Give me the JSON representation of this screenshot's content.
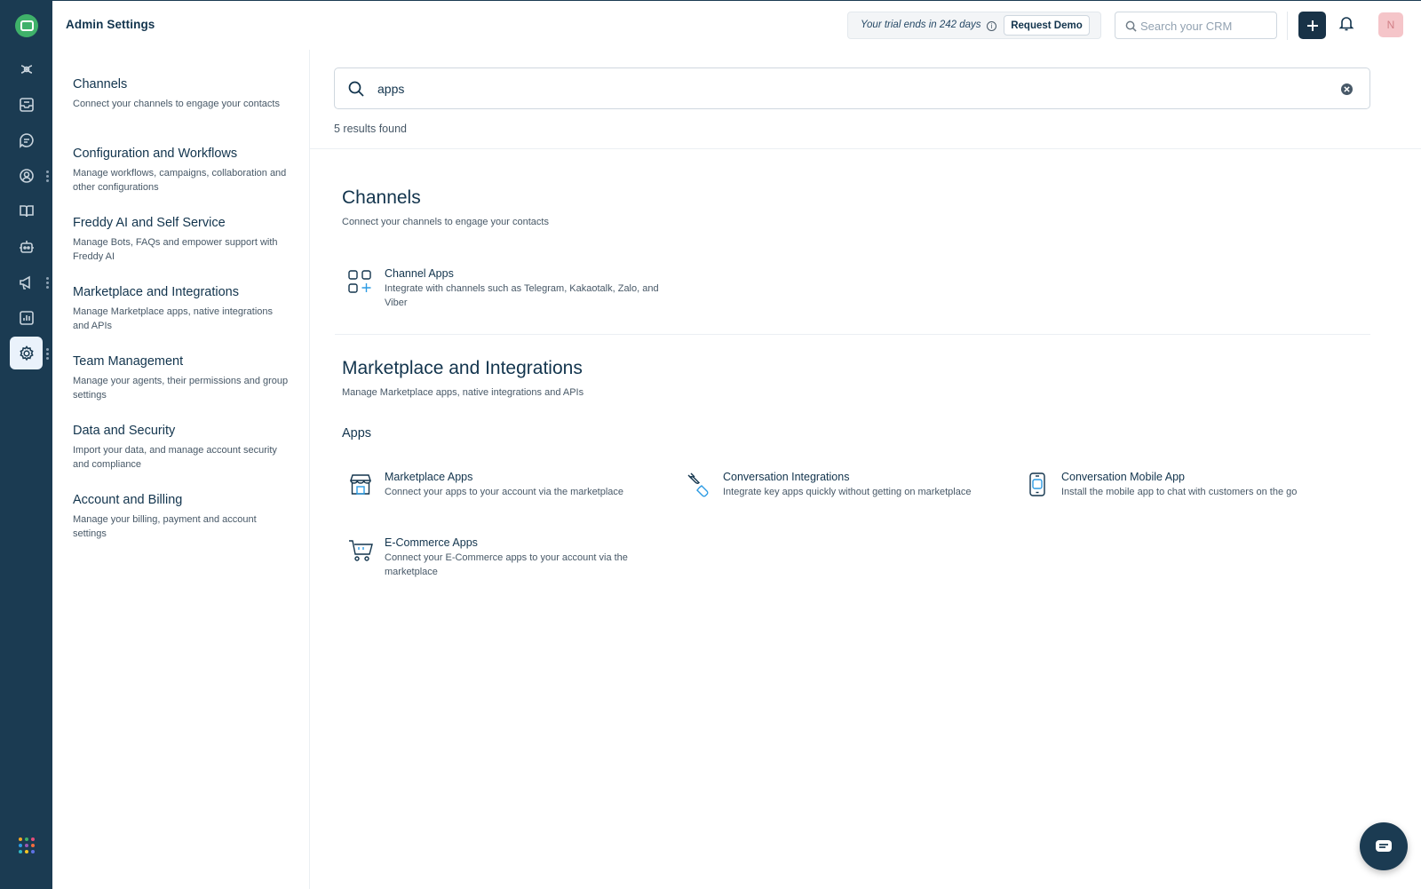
{
  "header": {
    "title": "Admin Settings",
    "trial_text": "Your trial ends in 242 days",
    "info_icon": "info-icon",
    "request_demo": "Request Demo",
    "search_placeholder": "Search your CRM",
    "avatar_initial": "N"
  },
  "rail": {
    "icons": [
      "freddy-ai-icon",
      "inbox-icon",
      "conversations-icon",
      "contacts-icon",
      "knowledge-base-icon",
      "bots-icon",
      "campaigns-icon",
      "reports-icon",
      "settings-icon"
    ],
    "apps_grid_colors": [
      "#f5a623",
      "#3fb16a",
      "#e54d7a",
      "#2c9be3",
      "#9b59b6",
      "#f56b3c",
      "#30b9c4",
      "#f5c523",
      "#5e72e4"
    ]
  },
  "settings_nav": [
    {
      "title": "Channels",
      "desc": "Connect your channels to engage your contacts"
    },
    {
      "title": "Configuration and Workflows",
      "desc": "Manage workflows, campaigns, collaboration and other configurations"
    },
    {
      "title": "Freddy AI and Self Service",
      "desc": "Manage Bots, FAQs and empower support with Freddy AI"
    },
    {
      "title": "Marketplace and Integrations",
      "desc": "Manage Marketplace apps, native integrations and APIs"
    },
    {
      "title": "Team Management",
      "desc": "Manage your agents, their permissions and group settings"
    },
    {
      "title": "Data and Security",
      "desc": "Import your data, and manage account security and compliance"
    },
    {
      "title": "Account and Billing",
      "desc": "Manage your billing, payment and account settings"
    }
  ],
  "search": {
    "value": "apps",
    "results_count": "5 results found"
  },
  "sections": [
    {
      "title": "Channels",
      "desc": "Connect your channels to engage your contacts",
      "results": [
        {
          "title": "Channel Apps",
          "desc": "Integrate with channels such as Telegram, Kakaotalk, Zalo, and Viber",
          "icon": "channel-apps-icon"
        }
      ]
    },
    {
      "title": "Marketplace and Integrations",
      "desc": "Manage Marketplace apps, native integrations and APIs",
      "subtitle": "Apps",
      "results": [
        {
          "title": "Marketplace Apps",
          "desc": "Connect your apps to your account via the marketplace",
          "icon": "marketplace-store-icon"
        },
        {
          "title": "Conversation Integrations",
          "desc": "Integrate key apps quickly without getting on marketplace",
          "icon": "plug-integration-icon"
        },
        {
          "title": "Conversation Mobile App",
          "desc": "Install the mobile app to chat with customers on the go",
          "icon": "mobile-app-icon"
        },
        {
          "title": "E-Commerce Apps",
          "desc": "Connect your E-Commerce apps to your account via the marketplace",
          "icon": "shopping-cart-icon"
        }
      ]
    }
  ],
  "colors": {
    "rail_bg": "#1b3b52",
    "accent_green": "#3fb16a",
    "accent_blue": "#2c9be3",
    "text_primary": "#12344d",
    "text_secondary": "#475867"
  }
}
